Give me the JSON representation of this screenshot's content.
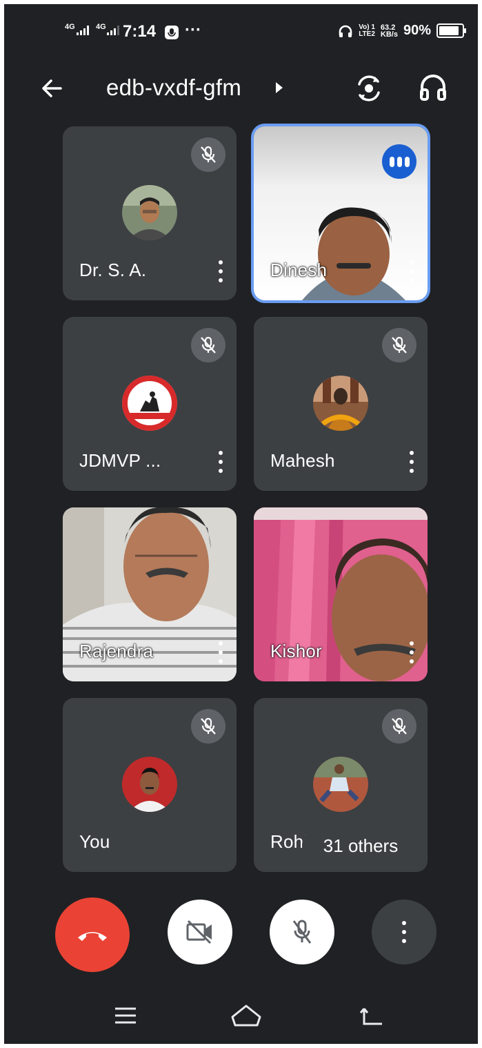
{
  "status_bar": {
    "sig1": "4G",
    "sig2": "4G",
    "time": "7:14",
    "dots": "···",
    "volte": "Vo) 1\nLTE2",
    "speed": "63.2\nKB/s",
    "battery": "90%",
    "battery_level": 0.9
  },
  "header": {
    "meeting_code": "edb-vxdf-gfm"
  },
  "participants": [
    {
      "name": "Dr. S. A.",
      "muted": true
    },
    {
      "name": "Dinesh",
      "speaking": true
    },
    {
      "name": "JDMVP ...",
      "muted": true
    },
    {
      "name": "Mahesh",
      "muted": true
    },
    {
      "name": "Rajendra"
    },
    {
      "name": "Kishor"
    },
    {
      "name": "You",
      "muted": true
    },
    {
      "name": "Rohit",
      "muted": true
    }
  ],
  "others_chip": "31 others",
  "colors": {
    "background": "#202124",
    "tile": "#3c4043",
    "end_call": "#ea4335",
    "active_border": "#6a9df3",
    "speaking": "#1a5fd1"
  }
}
